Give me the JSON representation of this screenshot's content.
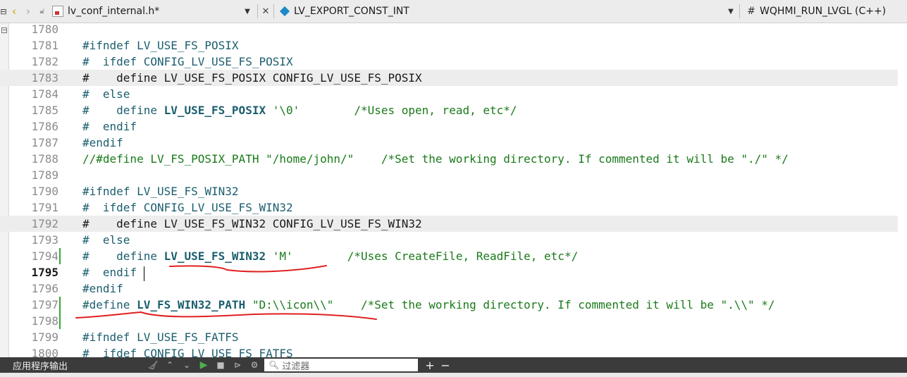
{
  "toolbar": {
    "file_name": "lv_conf_internal.h*",
    "symbol": "LV_EXPORT_CONST_INT",
    "hash": "#",
    "project": "WQHMI_RUN_LVGL (C++)"
  },
  "colors": {
    "preprocessor": "#1b5e6e",
    "comment": "#1a7a1a",
    "string": "#1a7a1a",
    "change_marker": "#3aa53a",
    "annotation": "#e02020"
  },
  "code_lines": [
    {
      "num": "1780",
      "tokens": []
    },
    {
      "num": "1781",
      "tokens": [
        {
          "t": "#ifndef LV_USE_FS_POSIX",
          "c": "pre"
        }
      ]
    },
    {
      "num": "1782",
      "tokens": [
        {
          "t": "#  ifdef CONFIG_LV_USE_FS_POSIX",
          "c": "pre"
        }
      ]
    },
    {
      "num": "1783",
      "highlight": true,
      "tokens": [
        {
          "t": "#    define LV_USE_FS_POSIX CONFIG_LV_USE_FS_POSIX",
          "c": "plain"
        }
      ]
    },
    {
      "num": "1784",
      "tokens": [
        {
          "t": "#  else",
          "c": "pre"
        }
      ]
    },
    {
      "num": "1785",
      "tokens": [
        {
          "t": "#    define ",
          "c": "pre"
        },
        {
          "t": "LV_USE_FS_POSIX",
          "c": "macro"
        },
        {
          "t": " '\\0'",
          "c": "str"
        },
        {
          "t": "        /*Uses open, read, etc*/",
          "c": "cmt"
        }
      ]
    },
    {
      "num": "1786",
      "tokens": [
        {
          "t": "#  endif",
          "c": "pre"
        }
      ]
    },
    {
      "num": "1787",
      "tokens": [
        {
          "t": "#endif",
          "c": "pre"
        }
      ]
    },
    {
      "num": "1788",
      "tokens": [
        {
          "t": "//#define LV_FS_POSIX_PATH \"/home/john/\"    /*Set the working directory. If commented it will be \"./\" */",
          "c": "cmt"
        }
      ]
    },
    {
      "num": "1789",
      "tokens": []
    },
    {
      "num": "1790",
      "tokens": [
        {
          "t": "#ifndef LV_USE_FS_WIN32",
          "c": "pre"
        }
      ]
    },
    {
      "num": "1791",
      "tokens": [
        {
          "t": "#  ifdef CONFIG_LV_USE_FS_WIN32",
          "c": "pre"
        }
      ]
    },
    {
      "num": "1792",
      "highlight": true,
      "tokens": [
        {
          "t": "#    define LV_USE_FS_WIN32 CONFIG_LV_USE_FS_WIN32",
          "c": "plain"
        }
      ]
    },
    {
      "num": "1793",
      "tokens": [
        {
          "t": "#  else",
          "c": "pre"
        }
      ]
    },
    {
      "num": "1794",
      "mark": true,
      "tokens": [
        {
          "t": "#    define ",
          "c": "pre"
        },
        {
          "t": "LV_USE_FS_WIN32",
          "c": "macro"
        },
        {
          "t": " 'M'",
          "c": "str"
        },
        {
          "t": "        /*Uses CreateFile, ReadFile, etc*/",
          "c": "cmt"
        }
      ]
    },
    {
      "num": "1795",
      "current": true,
      "tokens": [
        {
          "t": "#  endif",
          "c": "pre"
        }
      ]
    },
    {
      "num": "1796",
      "tokens": [
        {
          "t": "#endif",
          "c": "pre"
        }
      ]
    },
    {
      "num": "1797",
      "mark": true,
      "tokens": [
        {
          "t": "#define ",
          "c": "pre"
        },
        {
          "t": "LV_FS_WIN32_PATH",
          "c": "macro"
        },
        {
          "t": " \"D:\\\\icon\\\\\"",
          "c": "str"
        },
        {
          "t": "    /*Set the working directory. If commented it will be \".\\\\\" */",
          "c": "cmt"
        }
      ]
    },
    {
      "num": "1798",
      "mark": true,
      "tokens": []
    },
    {
      "num": "1799",
      "tokens": [
        {
          "t": "#ifndef LV_USE_FS_FATFS",
          "c": "pre"
        }
      ]
    },
    {
      "num": "1800",
      "tokens": [
        {
          "t": "#  ifdef CONFIG_LV_USE_FS_FATFS",
          "c": "pre"
        }
      ]
    }
  ],
  "bottom_panel": {
    "title": "应用程序输出",
    "filter_placeholder": "过滤器",
    "plus": "+",
    "minus": "−"
  }
}
